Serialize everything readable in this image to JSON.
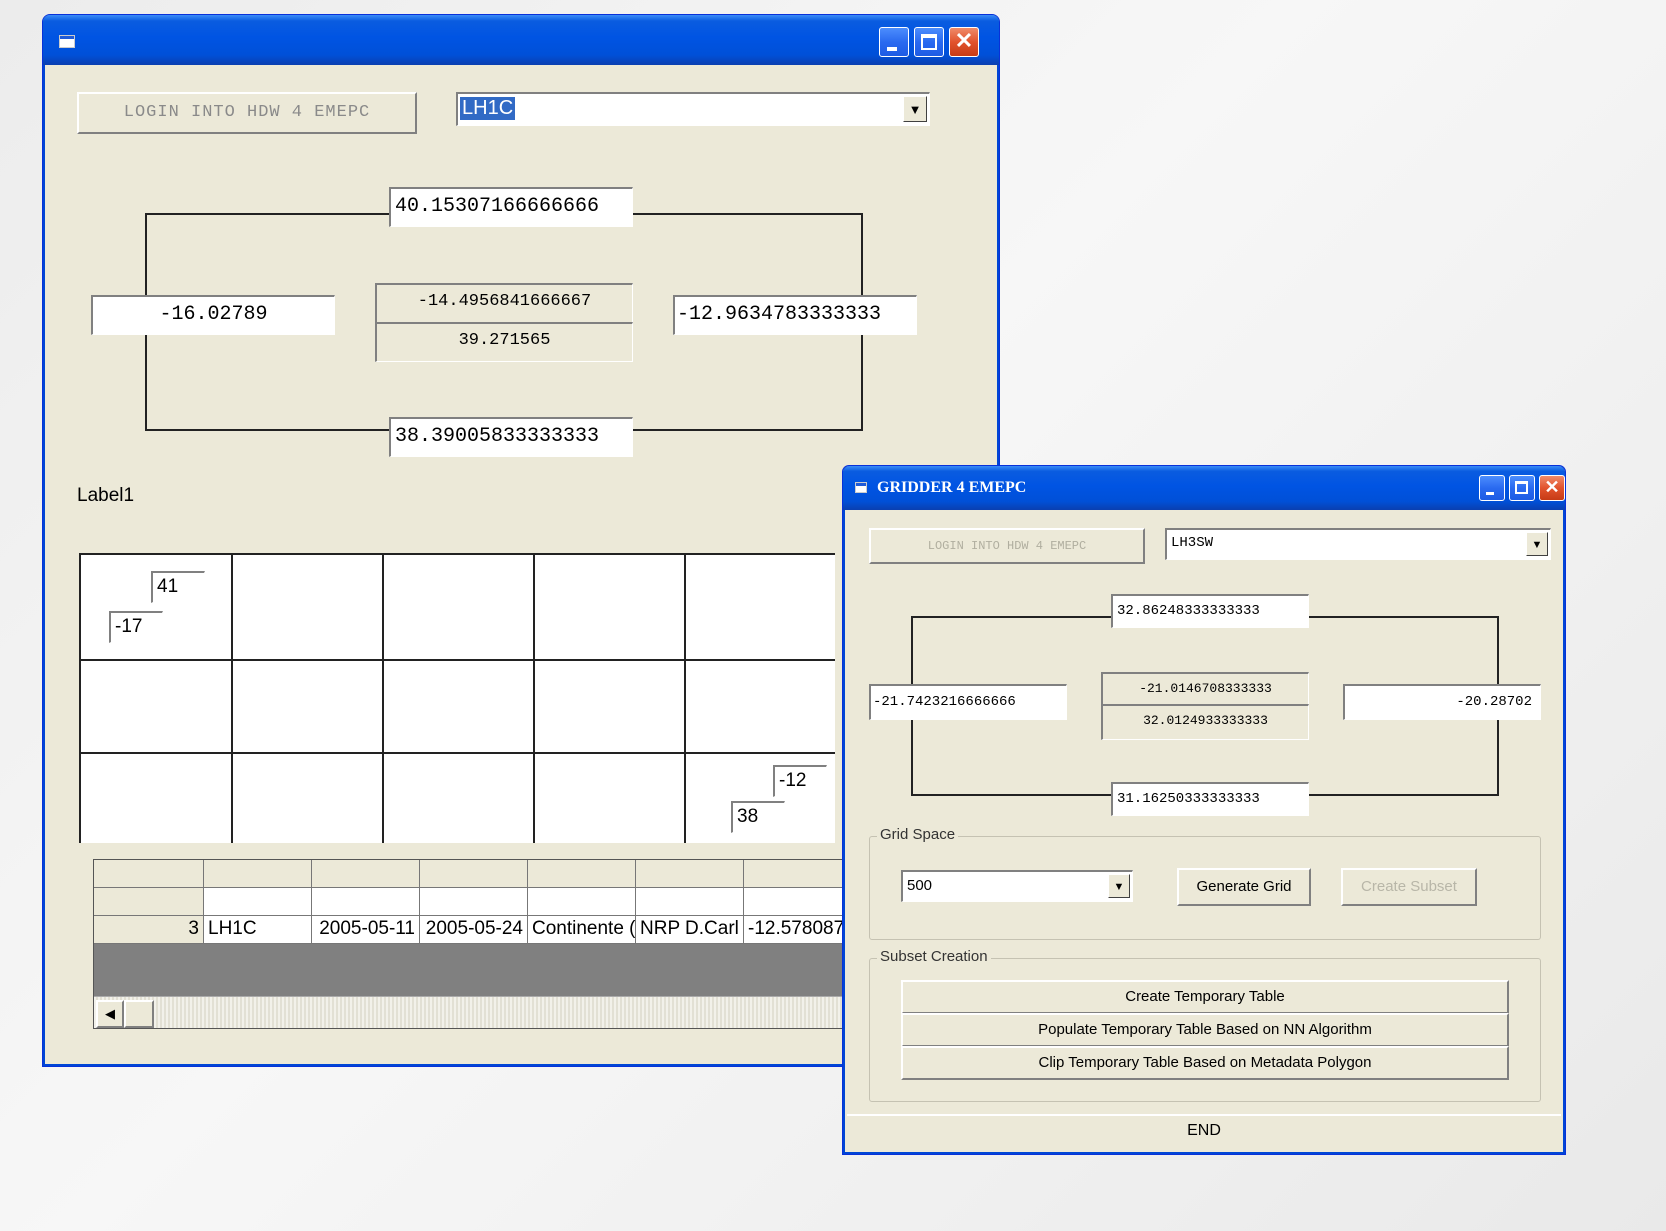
{
  "window1": {
    "title": "",
    "login_label": "LOGIN INTO HDW 4 EMEPC",
    "combo_value": "LH1C",
    "top_value": "40.15307166666666",
    "left_value": "-16.02789",
    "center_top_value": "-14.4956841666667",
    "center_bottom_value": "39.271565",
    "right_value": "-12.9634783333333",
    "bottom_value": "38.39005833333333",
    "label1": "Label1",
    "grid_labels": {
      "top": "41",
      "left": "-17",
      "right": "-12",
      "bottom": "38"
    },
    "table_row": [
      "3",
      "LH1C",
      "2005-05-11",
      "2005-05-24",
      "Continente (",
      "NRP D.Carl",
      "-12.578087"
    ]
  },
  "window2": {
    "title": "GRIDDER 4 EMEPC",
    "login_label": "LOGIN INTO HDW 4 EMEPC",
    "combo_value": "LH3SW",
    "top_value": "32.86248333333333",
    "left_value": "-21.7423216666666",
    "center_top_value": "-21.0146708333333",
    "center_bottom_value": "32.0124933333333",
    "right_value": "-20.28702",
    "bottom_value": "31.16250333333333",
    "grid_space_title": "Grid Space",
    "grid_space_value": "500",
    "generate_grid_label": "Generate Grid",
    "create_subset_label": "Create Subset",
    "subset_creation_title": "Subset Creation",
    "create_temp_table_label": "Create Temporary Table",
    "populate_temp_table_label": "Populate Temporary Table Based on NN Algorithm",
    "clip_temp_table_label": "Clip Temporary Table Based on Metadata Polygon",
    "end_label": "END"
  },
  "colors": {
    "xp_title": "#0054e3",
    "face": "#ece9d8",
    "selection": "#316ac5"
  }
}
